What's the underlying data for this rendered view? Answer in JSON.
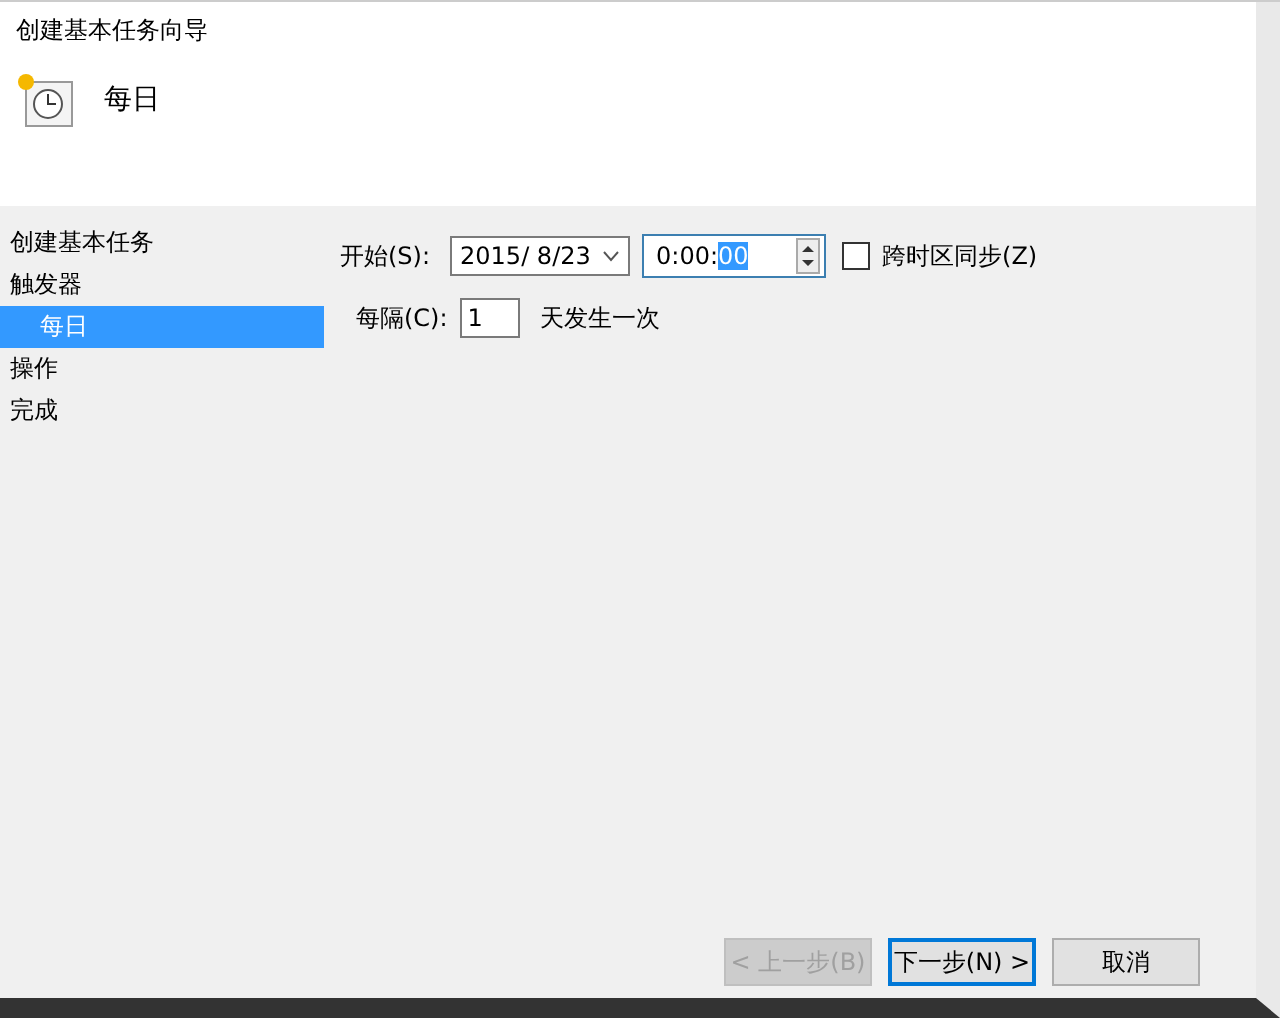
{
  "window": {
    "title": "创建基本任务向导"
  },
  "header": {
    "title": "每日"
  },
  "sidebar": {
    "items": [
      {
        "label": "创建基本任务",
        "selected": false
      },
      {
        "label": "触发器",
        "selected": false,
        "children": [
          {
            "label": "每日",
            "selected": true
          }
        ]
      },
      {
        "label": "操作",
        "selected": false
      },
      {
        "label": "完成",
        "selected": false
      }
    ]
  },
  "form": {
    "start_label": "开始(S):",
    "date": "2015/  8/23",
    "time": {
      "value": "0:00:",
      "selected_part": "00"
    },
    "sync": {
      "label": "跨时区同步(Z)",
      "checked": false
    },
    "recur_label": "每隔(C):",
    "recur_value": "1",
    "recur_suffix": "天发生一次"
  },
  "buttons": [
    {
      "label": "< 上一步(B)",
      "disabled": true,
      "default": false
    },
    {
      "label": "下一步(N) >",
      "disabled": false,
      "default": true
    },
    {
      "label": "取消",
      "disabled": false,
      "default": false
    }
  ]
}
